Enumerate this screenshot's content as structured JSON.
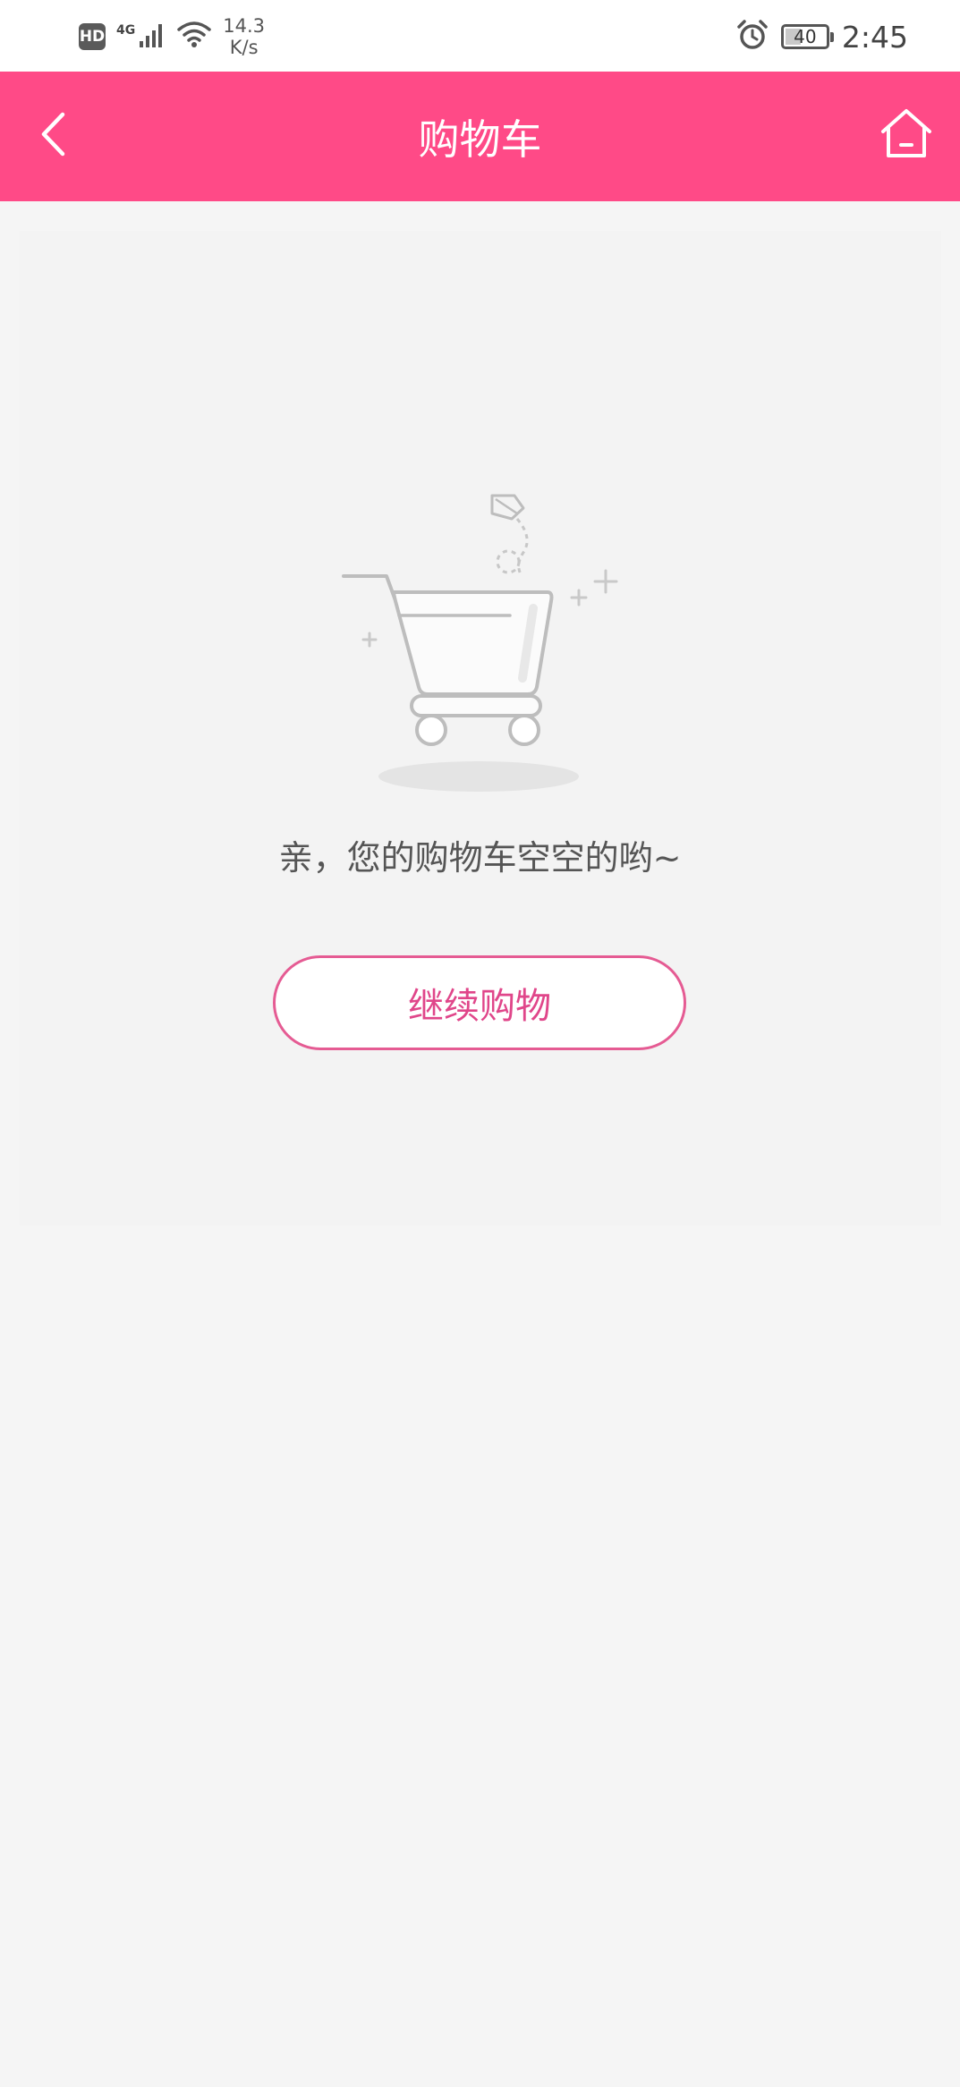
{
  "status_bar": {
    "hd_label": "HD",
    "network_type": "4G",
    "speed_value": "14.3",
    "speed_unit": "K/s",
    "battery_level": "40",
    "battery_fraction": 0.4,
    "time": "2:45",
    "icons": [
      "signal-icon",
      "wifi-icon",
      "alarm-icon",
      "battery-icon"
    ]
  },
  "header": {
    "title": "购物车",
    "background_color": "#ff4a87",
    "icons": [
      "back-arrow-icon",
      "home-icon"
    ]
  },
  "empty_state": {
    "illustration": "empty-cart-illustration",
    "message": "亲，您的购物车空空的哟~",
    "button_label": "继续购物",
    "accent_color": "#e0468a"
  }
}
